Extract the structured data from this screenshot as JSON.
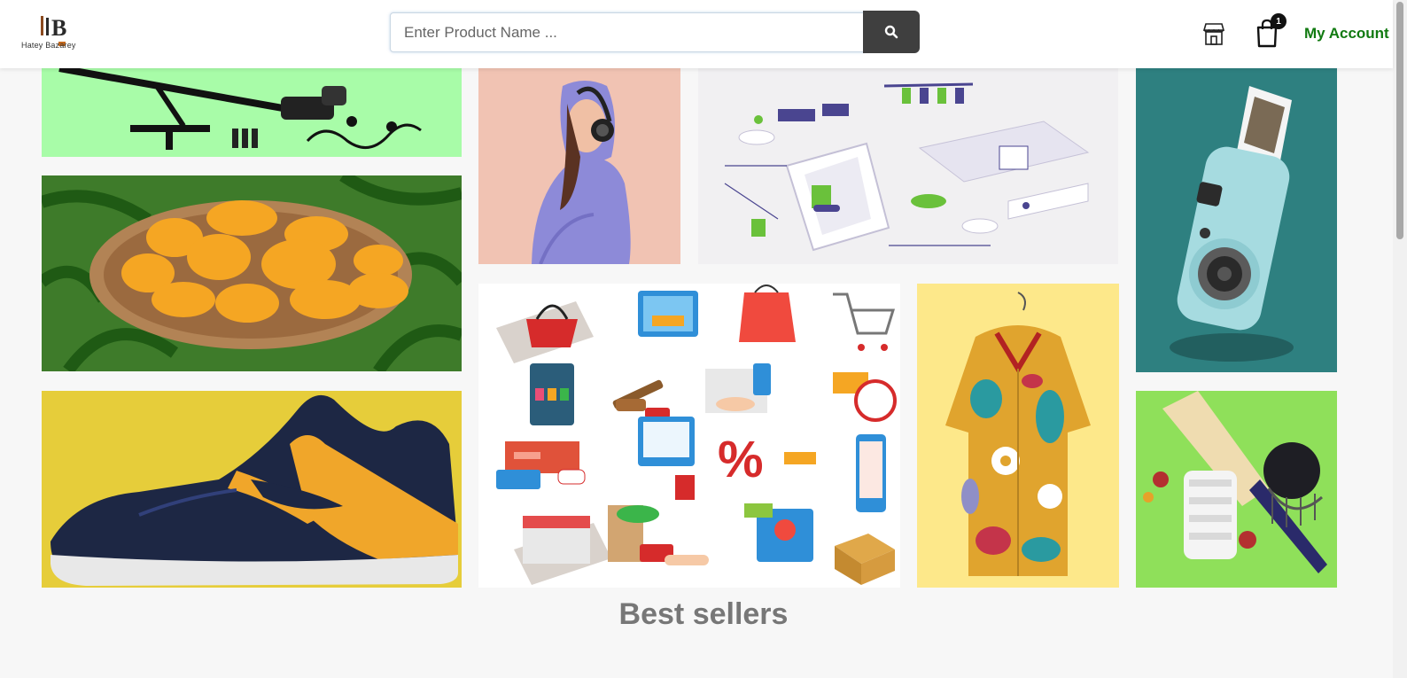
{
  "header": {
    "logo_text": "Hatey Bazarey",
    "search_placeholder": "Enter Product Name ...",
    "cart_count": "1",
    "account_label": "My Account"
  },
  "icons": {
    "search": "search-icon",
    "store": "store-icon",
    "cart": "shopping-bag-icon"
  },
  "colors": {
    "account_green": "#117a11",
    "search_button": "#3f3f3f",
    "tile_mic_bg": "#a8fca8",
    "tile_headphones_bg": "#f1c3b3",
    "tile_camera_bg": "#2e8080",
    "tile_shoe_bg": "#e6cd3a",
    "tile_shirt_bg": "#fde88a",
    "tile_cricket_bg": "#8fe05a"
  },
  "main": {
    "section_title": "Best sellers"
  }
}
